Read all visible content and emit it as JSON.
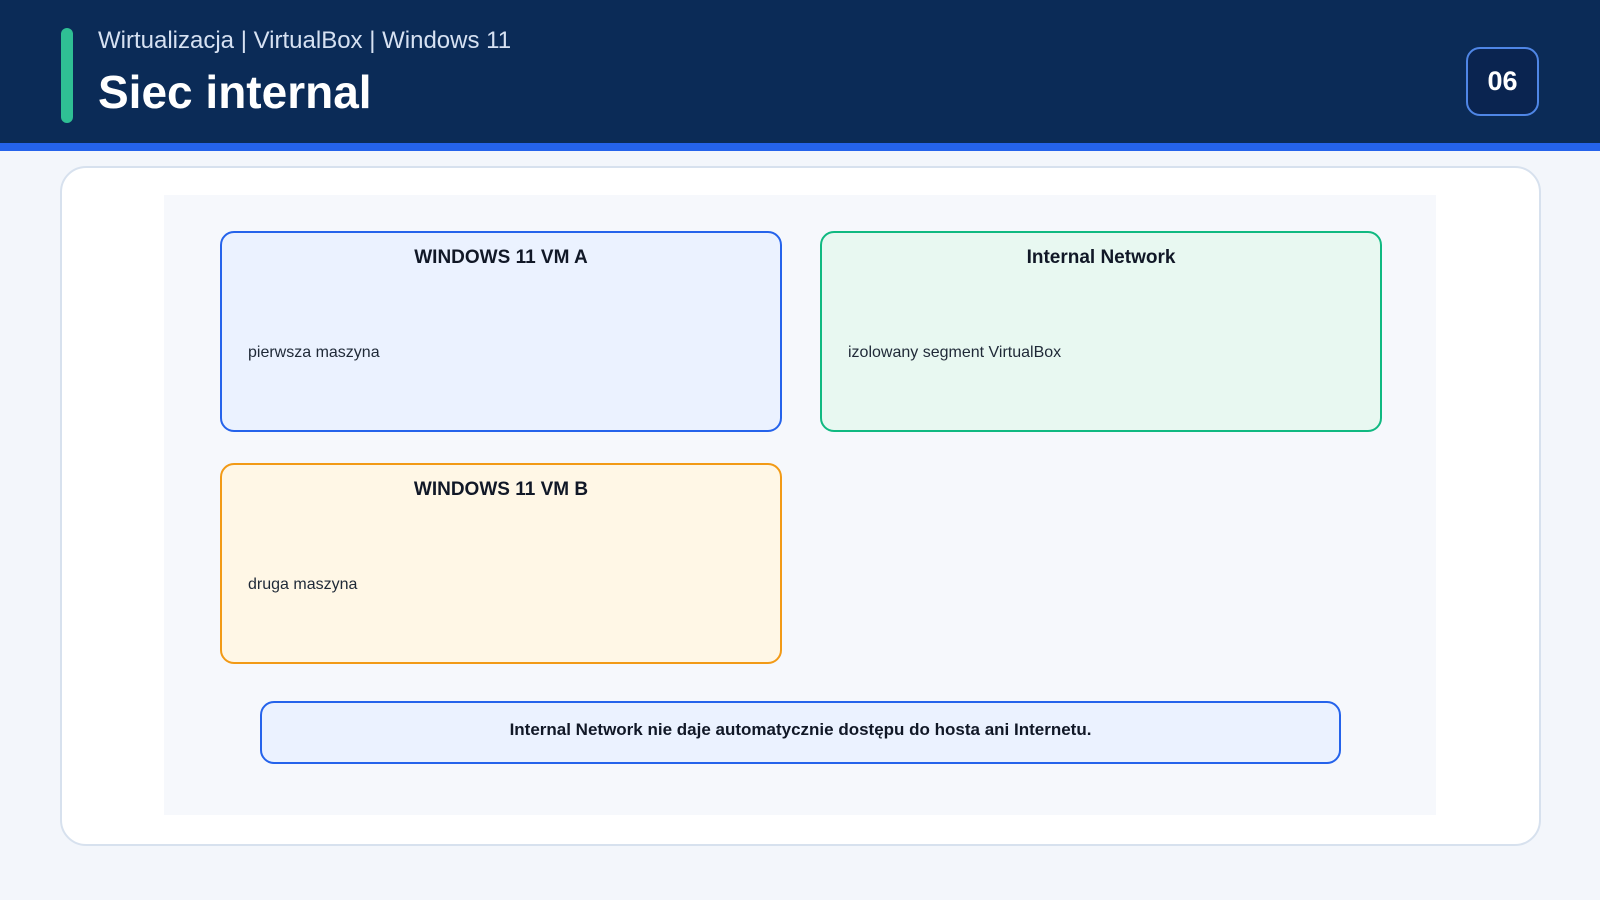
{
  "header": {
    "subtitle": "Wirtualizacja | VirtualBox | Windows 11",
    "title": "Siec internal",
    "page_number": "06"
  },
  "diagram": {
    "nodes": [
      {
        "id": "vm-a",
        "title": "WINDOWS 11 VM A",
        "description": "pierwsza maszyna"
      },
      {
        "id": "internal-network",
        "title": "Internal Network",
        "description": "izolowany segment VirtualBox"
      },
      {
        "id": "vm-b",
        "title": "WINDOWS 11 VM B",
        "description": "druga maszyna"
      }
    ],
    "note": "Internal Network nie daje automatycznie dostępu do hosta ani Internetu."
  },
  "colors": {
    "header_background": "#0b2b57",
    "header_stripe": "#2563eb",
    "accent": "#2fbf94",
    "vm_a_border": "#2563eb",
    "vm_a_fill": "#ebf2ff",
    "network_border": "#10b981",
    "network_fill": "#e8f8f1",
    "vm_b_border": "#f29a16",
    "vm_b_fill": "#fff7e6"
  }
}
